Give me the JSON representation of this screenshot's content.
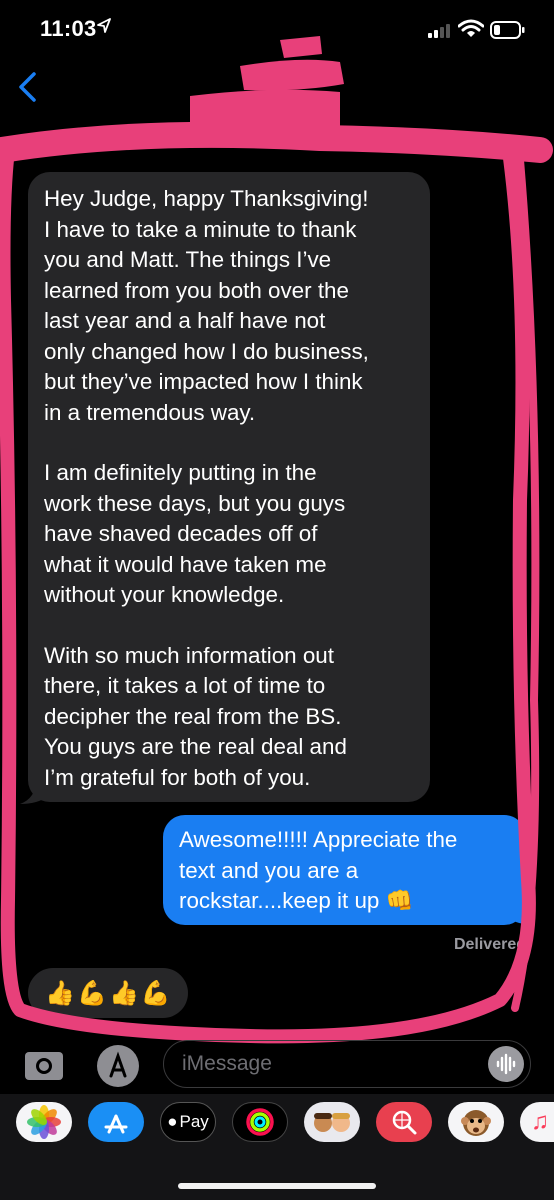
{
  "status_bar": {
    "time": "11:03"
  },
  "conversation": {
    "received": {
      "paragraphs": [
        "Hey Judge, happy Thanksgiving!\nI have to take a minute to thank\nyou and Matt. The things I’ve\nlearned from you both over the\nlast year and a half have not\nonly changed how I do business,\nbut they’ve impacted how I think\nin a tremendous way.",
        "I am definitely putting in the\nwork these days, but you guys\nhave shaved decades off of\nwhat it would have taken me\nwithout your knowledge.",
        "With so much information out\nthere, it takes a lot of time to\ndecipher the real from the BS.\nYou guys are the real deal and\nI’m grateful for both of you."
      ]
    },
    "sent": {
      "text": "Awesome!!!!!  Appreciate the\ntext and you are a\nrockstar....keep it up"
    },
    "sent_emoji": "👊",
    "delivered_label": "Delivered",
    "tapback": [
      "👍",
      "💪",
      "👍",
      "💪"
    ]
  },
  "input": {
    "placeholder": "iMessage"
  },
  "app_drawer": {
    "items": [
      {
        "name": "photos-icon"
      },
      {
        "name": "app-store-icon"
      },
      {
        "name": "apple-pay-icon",
        "label": "Pay"
      },
      {
        "name": "activity-icon"
      },
      {
        "name": "memoji-icon"
      },
      {
        "name": "web-search-icon"
      },
      {
        "name": "animoji-icon"
      },
      {
        "name": "music-icon"
      }
    ]
  },
  "colors": {
    "sent_bubble": "#1a7ef2",
    "received_bubble": "#262628",
    "accent": "#1a7ef2",
    "scribble": "#e8407a"
  }
}
